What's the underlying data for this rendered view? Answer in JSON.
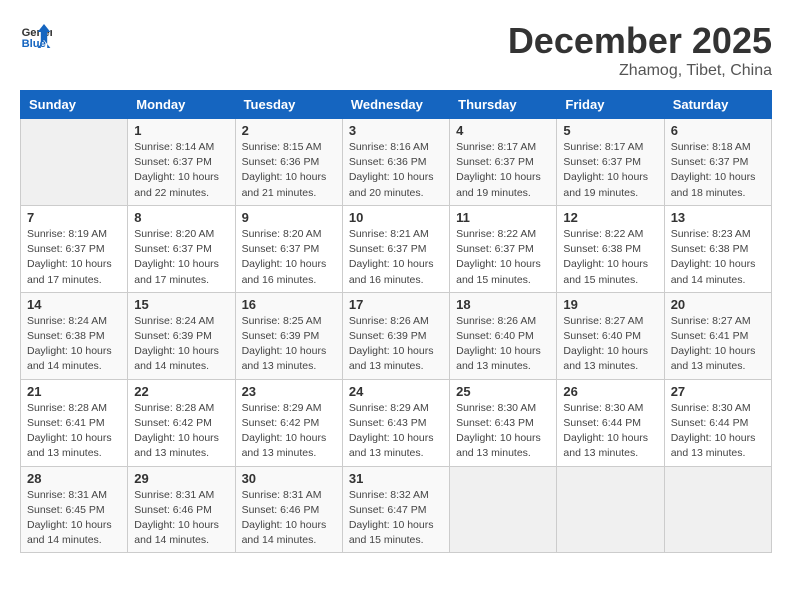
{
  "header": {
    "logo_general": "General",
    "logo_blue": "Blue",
    "month_title": "December 2025",
    "subtitle": "Zhamog, Tibet, China"
  },
  "days_of_week": [
    "Sunday",
    "Monday",
    "Tuesday",
    "Wednesday",
    "Thursday",
    "Friday",
    "Saturday"
  ],
  "weeks": [
    [
      {
        "day": "",
        "empty": true
      },
      {
        "day": "1",
        "sunrise": "8:14 AM",
        "sunset": "6:37 PM",
        "daylight": "10 hours and 22 minutes."
      },
      {
        "day": "2",
        "sunrise": "8:15 AM",
        "sunset": "6:36 PM",
        "daylight": "10 hours and 21 minutes."
      },
      {
        "day": "3",
        "sunrise": "8:16 AM",
        "sunset": "6:36 PM",
        "daylight": "10 hours and 20 minutes."
      },
      {
        "day": "4",
        "sunrise": "8:17 AM",
        "sunset": "6:37 PM",
        "daylight": "10 hours and 19 minutes."
      },
      {
        "day": "5",
        "sunrise": "8:17 AM",
        "sunset": "6:37 PM",
        "daylight": "10 hours and 19 minutes."
      },
      {
        "day": "6",
        "sunrise": "8:18 AM",
        "sunset": "6:37 PM",
        "daylight": "10 hours and 18 minutes."
      }
    ],
    [
      {
        "day": "7",
        "sunrise": "8:19 AM",
        "sunset": "6:37 PM",
        "daylight": "10 hours and 17 minutes."
      },
      {
        "day": "8",
        "sunrise": "8:20 AM",
        "sunset": "6:37 PM",
        "daylight": "10 hours and 17 minutes."
      },
      {
        "day": "9",
        "sunrise": "8:20 AM",
        "sunset": "6:37 PM",
        "daylight": "10 hours and 16 minutes."
      },
      {
        "day": "10",
        "sunrise": "8:21 AM",
        "sunset": "6:37 PM",
        "daylight": "10 hours and 16 minutes."
      },
      {
        "day": "11",
        "sunrise": "8:22 AM",
        "sunset": "6:37 PM",
        "daylight": "10 hours and 15 minutes."
      },
      {
        "day": "12",
        "sunrise": "8:22 AM",
        "sunset": "6:38 PM",
        "daylight": "10 hours and 15 minutes."
      },
      {
        "day": "13",
        "sunrise": "8:23 AM",
        "sunset": "6:38 PM",
        "daylight": "10 hours and 14 minutes."
      }
    ],
    [
      {
        "day": "14",
        "sunrise": "8:24 AM",
        "sunset": "6:38 PM",
        "daylight": "10 hours and 14 minutes."
      },
      {
        "day": "15",
        "sunrise": "8:24 AM",
        "sunset": "6:39 PM",
        "daylight": "10 hours and 14 minutes."
      },
      {
        "day": "16",
        "sunrise": "8:25 AM",
        "sunset": "6:39 PM",
        "daylight": "10 hours and 13 minutes."
      },
      {
        "day": "17",
        "sunrise": "8:26 AM",
        "sunset": "6:39 PM",
        "daylight": "10 hours and 13 minutes."
      },
      {
        "day": "18",
        "sunrise": "8:26 AM",
        "sunset": "6:40 PM",
        "daylight": "10 hours and 13 minutes."
      },
      {
        "day": "19",
        "sunrise": "8:27 AM",
        "sunset": "6:40 PM",
        "daylight": "10 hours and 13 minutes."
      },
      {
        "day": "20",
        "sunrise": "8:27 AM",
        "sunset": "6:41 PM",
        "daylight": "10 hours and 13 minutes."
      }
    ],
    [
      {
        "day": "21",
        "sunrise": "8:28 AM",
        "sunset": "6:41 PM",
        "daylight": "10 hours and 13 minutes."
      },
      {
        "day": "22",
        "sunrise": "8:28 AM",
        "sunset": "6:42 PM",
        "daylight": "10 hours and 13 minutes."
      },
      {
        "day": "23",
        "sunrise": "8:29 AM",
        "sunset": "6:42 PM",
        "daylight": "10 hours and 13 minutes."
      },
      {
        "day": "24",
        "sunrise": "8:29 AM",
        "sunset": "6:43 PM",
        "daylight": "10 hours and 13 minutes."
      },
      {
        "day": "25",
        "sunrise": "8:30 AM",
        "sunset": "6:43 PM",
        "daylight": "10 hours and 13 minutes."
      },
      {
        "day": "26",
        "sunrise": "8:30 AM",
        "sunset": "6:44 PM",
        "daylight": "10 hours and 13 minutes."
      },
      {
        "day": "27",
        "sunrise": "8:30 AM",
        "sunset": "6:44 PM",
        "daylight": "10 hours and 13 minutes."
      }
    ],
    [
      {
        "day": "28",
        "sunrise": "8:31 AM",
        "sunset": "6:45 PM",
        "daylight": "10 hours and 14 minutes."
      },
      {
        "day": "29",
        "sunrise": "8:31 AM",
        "sunset": "6:46 PM",
        "daylight": "10 hours and 14 minutes."
      },
      {
        "day": "30",
        "sunrise": "8:31 AM",
        "sunset": "6:46 PM",
        "daylight": "10 hours and 14 minutes."
      },
      {
        "day": "31",
        "sunrise": "8:32 AM",
        "sunset": "6:47 PM",
        "daylight": "10 hours and 15 minutes."
      },
      {
        "day": "",
        "empty": true
      },
      {
        "day": "",
        "empty": true
      },
      {
        "day": "",
        "empty": true
      }
    ]
  ]
}
